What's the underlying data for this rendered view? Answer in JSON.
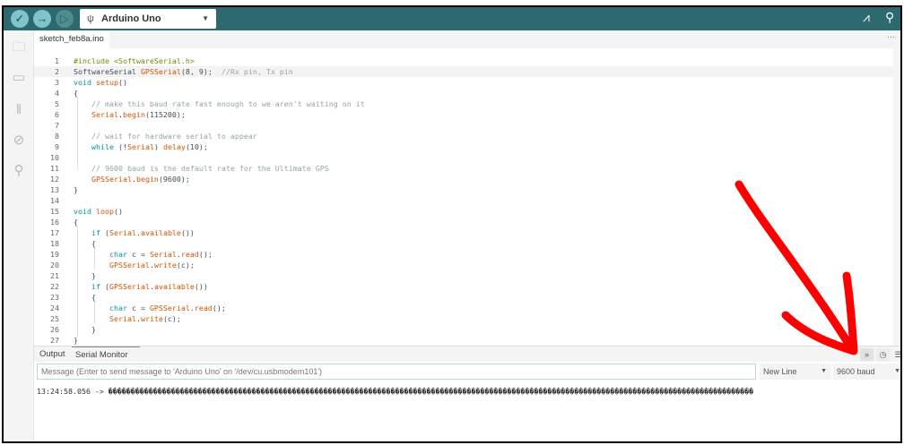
{
  "toolbar": {
    "board": "Arduino Uno"
  },
  "file_tab": "sketch_feb8a.ino",
  "tab_more": "···",
  "code": [
    [
      [
        "pp",
        "#include <SoftwareSerial.h>"
      ]
    ],
    [
      [
        "",
        "SoftwareSerial "
      ],
      [
        "fn",
        "GPSSerial"
      ],
      [
        "",
        "(8, 9);  "
      ],
      [
        "cm",
        "//Rx pin, Tx pin"
      ]
    ],
    [
      [
        "kw",
        "void "
      ],
      [
        "fn",
        "setup"
      ],
      [
        "",
        "()"
      ]
    ],
    [
      [
        "",
        "{"
      ]
    ],
    [
      [
        "",
        "    "
      ],
      [
        "cm",
        "// make this baud rate fast enough to we aren't waiting on it"
      ]
    ],
    [
      [
        "",
        "    "
      ],
      [
        "fn",
        "Serial"
      ],
      [
        "",
        "."
      ],
      [
        "fn",
        "begin"
      ],
      [
        "",
        "(115200);"
      ]
    ],
    [
      [
        "",
        ""
      ]
    ],
    [
      [
        "",
        "    "
      ],
      [
        "cm",
        "// wait for hardware serial to appear"
      ]
    ],
    [
      [
        "",
        "    "
      ],
      [
        "kw",
        "while"
      ],
      [
        "",
        " (!"
      ],
      [
        "fn",
        "Serial"
      ],
      [
        "",
        ") "
      ],
      [
        "fn",
        "delay"
      ],
      [
        "",
        "(10);"
      ]
    ],
    [
      [
        "",
        ""
      ]
    ],
    [
      [
        "",
        "    "
      ],
      [
        "cm",
        "// 9600 baud is the default rate for the Ultimate GPS"
      ]
    ],
    [
      [
        "",
        "    "
      ],
      [
        "fn",
        "GPSSerial"
      ],
      [
        "",
        "."
      ],
      [
        "fn",
        "begin"
      ],
      [
        "",
        "(9600);"
      ]
    ],
    [
      [
        "",
        "}"
      ]
    ],
    [
      [
        "",
        ""
      ]
    ],
    [
      [
        "kw",
        "void "
      ],
      [
        "fn",
        "loop"
      ],
      [
        "",
        "()"
      ]
    ],
    [
      [
        "",
        "{"
      ]
    ],
    [
      [
        "",
        "    "
      ],
      [
        "kw",
        "if"
      ],
      [
        "",
        " ("
      ],
      [
        "fn",
        "Serial"
      ],
      [
        "",
        "."
      ],
      [
        "fn",
        "available"
      ],
      [
        "",
        "())"
      ]
    ],
    [
      [
        "",
        "    {"
      ]
    ],
    [
      [
        "",
        "        "
      ],
      [
        "kw",
        "char"
      ],
      [
        "",
        " c = "
      ],
      [
        "fn",
        "Serial"
      ],
      [
        "",
        "."
      ],
      [
        "fn",
        "read"
      ],
      [
        "",
        "();"
      ]
    ],
    [
      [
        "",
        "        "
      ],
      [
        "fn",
        "GPSSerial"
      ],
      [
        "",
        "."
      ],
      [
        "fn",
        "write"
      ],
      [
        "",
        "(c);"
      ]
    ],
    [
      [
        "",
        "    }"
      ]
    ],
    [
      [
        "",
        "    "
      ],
      [
        "kw",
        "if"
      ],
      [
        "",
        " ("
      ],
      [
        "fn",
        "GPSSerial"
      ],
      [
        "",
        "."
      ],
      [
        "fn",
        "available"
      ],
      [
        "",
        "())"
      ]
    ],
    [
      [
        "",
        "    {"
      ]
    ],
    [
      [
        "",
        "        "
      ],
      [
        "kw",
        "char"
      ],
      [
        "",
        " c = "
      ],
      [
        "fn",
        "GPSSerial"
      ],
      [
        "",
        "."
      ],
      [
        "fn",
        "read"
      ],
      [
        "",
        "();"
      ]
    ],
    [
      [
        "",
        "        "
      ],
      [
        "fn",
        "Serial"
      ],
      [
        "",
        "."
      ],
      [
        "fn",
        "write"
      ],
      [
        "",
        "(c);"
      ]
    ],
    [
      [
        "",
        "    }"
      ]
    ],
    [
      [
        "",
        "}"
      ]
    ]
  ],
  "current_line": 2,
  "panel": {
    "tab_output": "Output",
    "tab_serial": "Serial Monitor",
    "close": "×",
    "message_placeholder": "Message (Enter to send message to 'Arduino Uno' on '/dev/cu.usbmodem101')",
    "line_ending": "New Line",
    "baud": "9600 baud",
    "output_line": "13:24:58.056 -> ������������������������������������������������������������������������������������������������������������������������������������������������"
  },
  "annotation_color": "#ff0000"
}
